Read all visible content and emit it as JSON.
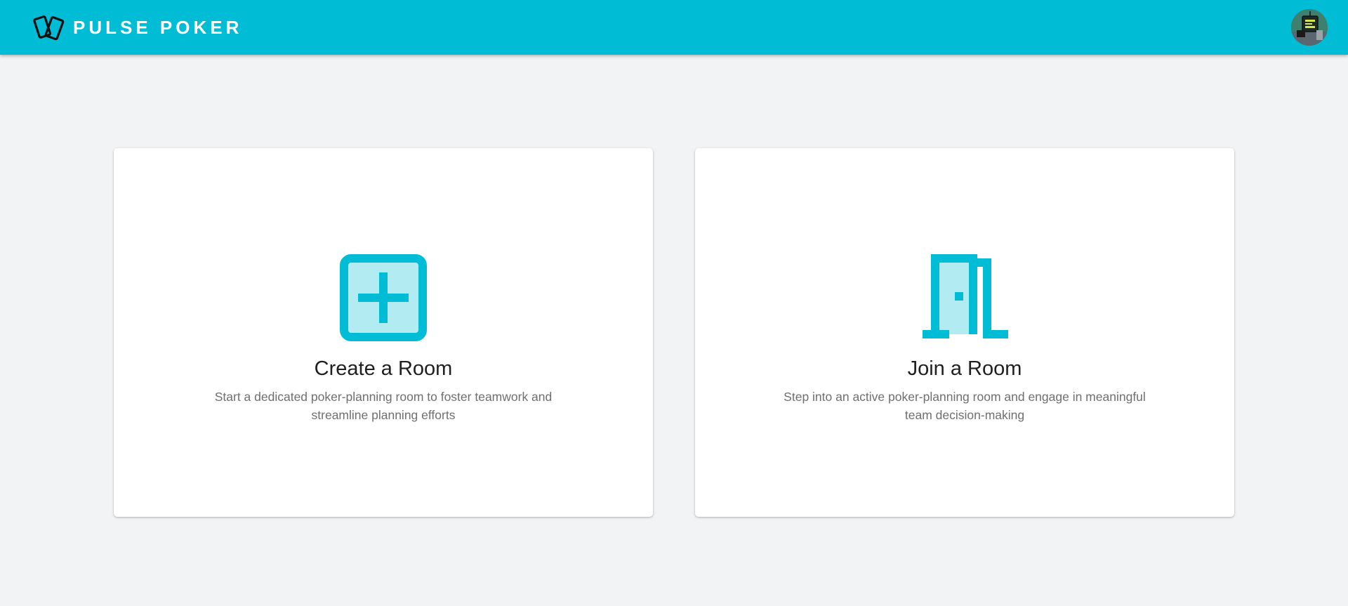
{
  "header": {
    "brand_name": "PULSE POKER",
    "logo_icon": "cards-icon",
    "avatar_icon": "user-avatar"
  },
  "colors": {
    "accent": "#00bcd4",
    "accent_light": "#b2ebf2",
    "background": "#f2f3f5",
    "card": "#ffffff",
    "title_text": "#1f1f1f",
    "desc_text": "#6f6f6f"
  },
  "cards": [
    {
      "icon": "add-box-icon",
      "title": "Create a Room",
      "description": "Start a dedicated poker-planning room to foster teamwork and streamline planning efforts"
    },
    {
      "icon": "door-icon",
      "title": "Join a Room",
      "description": "Step into an active poker-planning room and engage in meaningful team decision-making"
    }
  ]
}
